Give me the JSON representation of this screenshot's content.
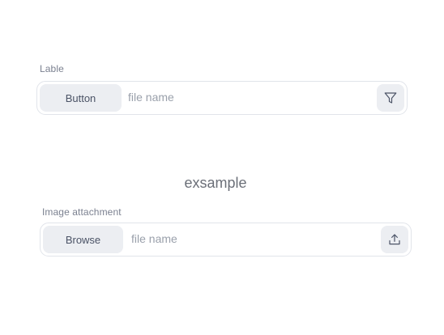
{
  "first_field": {
    "label": "Lable",
    "button_label": "Button",
    "file_name_placeholder": "file name",
    "action_icon": "filter-icon"
  },
  "section": {
    "title": "exsample"
  },
  "second_field": {
    "label": "Image attachment",
    "button_label": "Browse",
    "file_name_placeholder": "file name",
    "action_icon": "upload-icon"
  }
}
